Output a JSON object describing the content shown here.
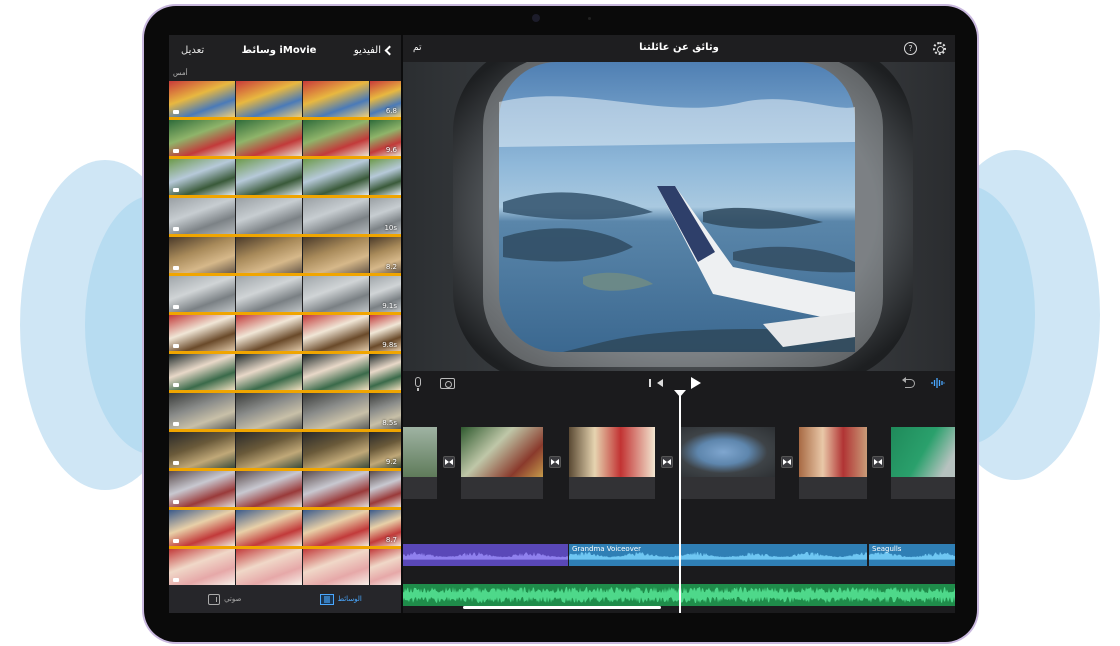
{
  "media_panel": {
    "back_label": "الفيديو",
    "title": "وسائط iMovie",
    "edit_label": "تعديل",
    "section_label": "أمس",
    "clips": [
      {
        "duration": "6.8"
      },
      {
        "duration": "9.6"
      },
      {
        "duration": ""
      },
      {
        "duration": "10s"
      },
      {
        "duration": "8.2"
      },
      {
        "duration": "9.1s"
      },
      {
        "duration": "9.8s"
      },
      {
        "duration": ""
      },
      {
        "duration": "8.5s"
      },
      {
        "duration": "9.2"
      },
      {
        "duration": ""
      },
      {
        "duration": "8.7"
      },
      {
        "duration": ""
      }
    ],
    "tabs": {
      "audio": "صوتي",
      "media": "الوسائط"
    }
  },
  "project": {
    "title": "وثائق عن عائلتنا",
    "done_label": "تم",
    "help_symbol": "?"
  },
  "timeline": {
    "audio_tracks": [
      {
        "label": "Grandma Voiceover",
        "color": "#2f7fb5"
      },
      {
        "label": "Seagulls",
        "color": "#2f7fb5"
      }
    ],
    "background_music_color": "#1f8c4a",
    "voiceover_left_color": "#5a48b8"
  },
  "colors": {
    "accent": "#4aa8ff",
    "clip_bar": "#f0a500"
  }
}
